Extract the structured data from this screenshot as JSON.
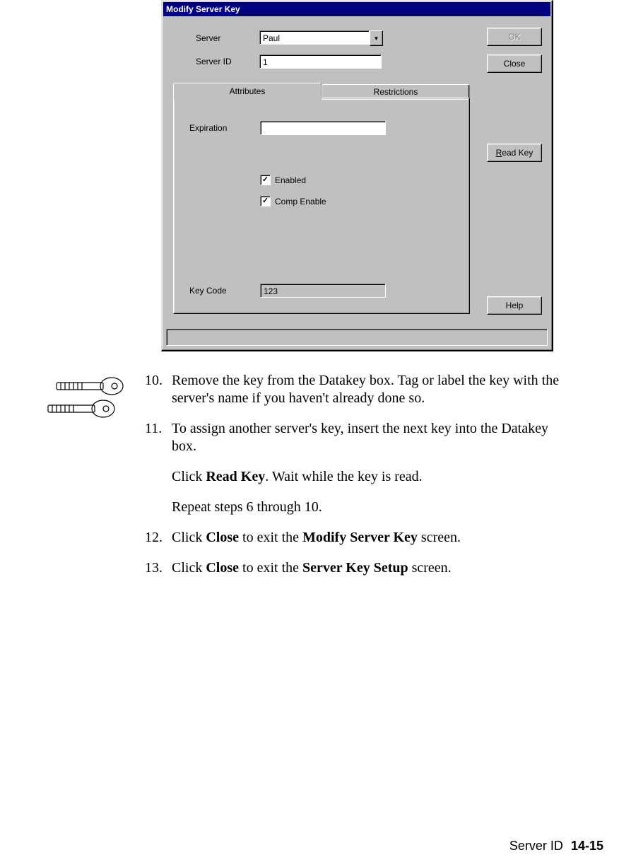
{
  "dialog": {
    "title": "Modify Server Key",
    "server_label": "Server",
    "server_value": "Paul",
    "server_id_label": "Server ID",
    "server_id_value": "1",
    "buttons": {
      "ok": "OK",
      "close": "Close",
      "read_key": "Read Key",
      "read_key_accel": "R",
      "help": "Help"
    },
    "tabs": {
      "attributes": "Attributes",
      "restrictions": "Restrictions",
      "active": "attributes"
    },
    "attributes_page": {
      "expiration_label": "Expiration",
      "expiration_value": "",
      "enabled_label": "Enabled",
      "enabled_checked": true,
      "comp_enable_label": "Comp Enable",
      "comp_enable_checked": true,
      "key_code_label": "Key Code",
      "key_code_value": "123"
    }
  },
  "steps": [
    {
      "n": "10.",
      "paras": [
        [
          {
            "t": "Remove the key from the Datakey box. Tag or label the key with the server's name if you haven't already done so."
          }
        ]
      ]
    },
    {
      "n": "11.",
      "paras": [
        [
          {
            "t": "To assign another server's key, insert the next key into the Datakey box."
          }
        ],
        [
          {
            "t": "Click "
          },
          {
            "b": true,
            "t": "Read Key"
          },
          {
            "t": ". Wait while the key is read."
          }
        ],
        [
          {
            "t": "Repeat steps 6 through 10."
          }
        ]
      ]
    },
    {
      "n": "12.",
      "paras": [
        [
          {
            "t": "Click "
          },
          {
            "b": true,
            "t": "Close"
          },
          {
            "t": " to exit the "
          },
          {
            "b": true,
            "t": "Modify Server Key"
          },
          {
            "t": " screen."
          }
        ]
      ]
    },
    {
      "n": "13.",
      "paras": [
        [
          {
            "t": "Click "
          },
          {
            "b": true,
            "t": "Close"
          },
          {
            "t": " to exit the "
          },
          {
            "b": true,
            "t": "Server Key Setup"
          },
          {
            "t": " screen."
          }
        ]
      ]
    }
  ],
  "footer": {
    "section": "Server ID",
    "page": "14-15"
  }
}
